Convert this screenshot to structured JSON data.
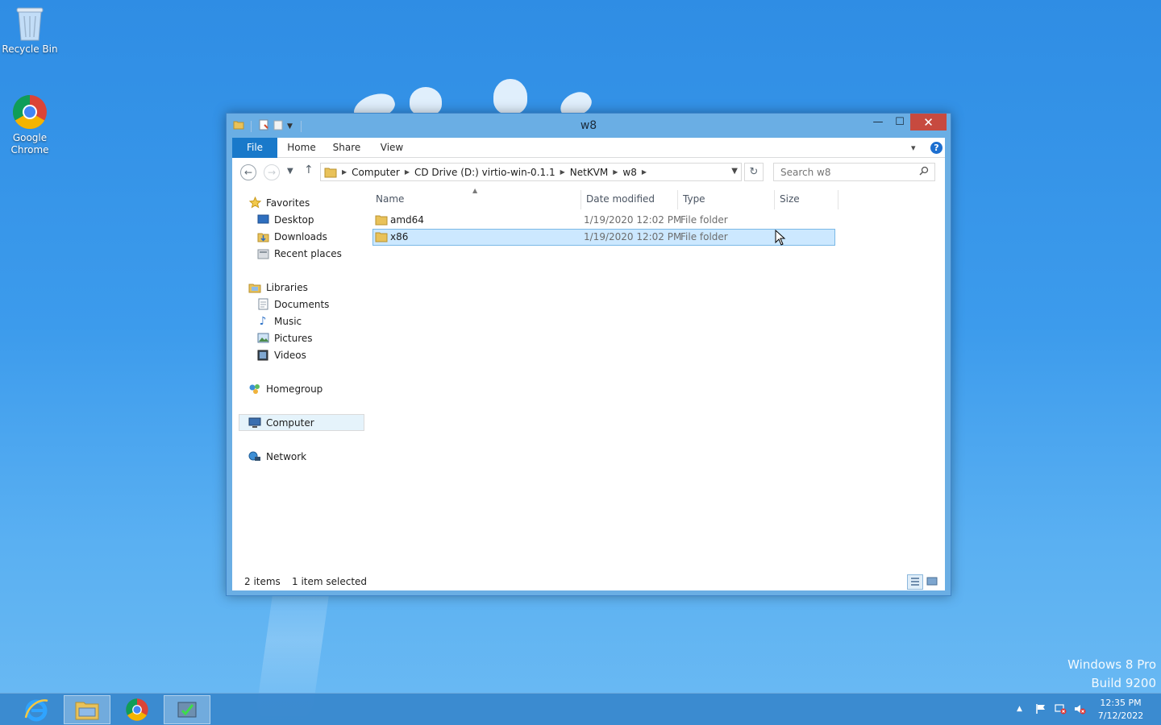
{
  "desktop": {
    "icons": [
      {
        "label": "Recycle Bin",
        "icon": "recycle-bin-icon"
      },
      {
        "label": "Google Chrome",
        "icon": "chrome-icon"
      }
    ],
    "watermark": {
      "line1": "Windows 8 Pro",
      "line2": "Build 9200"
    }
  },
  "window": {
    "title": "w8",
    "controls": {
      "minimize": "—",
      "maximize": "☐",
      "close": "✕"
    },
    "ribbon": {
      "tabs": [
        "File",
        "Home",
        "Share",
        "View"
      ],
      "help": "?"
    },
    "address": {
      "crumbs": [
        "Computer",
        "CD Drive (D:) virtio-win-0.1.1",
        "NetKVM",
        "w8"
      ]
    },
    "search": {
      "placeholder": "Search w8"
    },
    "navpane": {
      "favorites": {
        "label": "Favorites",
        "items": [
          "Desktop",
          "Downloads",
          "Recent places"
        ]
      },
      "libraries": {
        "label": "Libraries",
        "items": [
          "Documents",
          "Music",
          "Pictures",
          "Videos"
        ]
      },
      "homegroup": "Homegroup",
      "computer": "Computer",
      "network": "Network"
    },
    "columns": {
      "name": "Name",
      "date": "Date modified",
      "type": "Type",
      "size": "Size"
    },
    "files": [
      {
        "name": "amd64",
        "date": "1/19/2020 12:02 PM",
        "type": "File folder",
        "size": "",
        "selected": false
      },
      {
        "name": "x86",
        "date": "1/19/2020 12:02 PM",
        "type": "File folder",
        "size": "",
        "selected": true
      }
    ],
    "status": {
      "count": "2 items",
      "selection": "1 item selected"
    }
  },
  "taskbar": {
    "apps": [
      "internet-explorer-icon",
      "file-explorer-icon",
      "chrome-icon",
      "app-icon"
    ],
    "clock": {
      "time": "12:35 PM",
      "date": "7/12/2022"
    }
  },
  "colors": {
    "accent": "#1979ca",
    "selection": "#cce8ff",
    "close": "#c74a3f"
  }
}
